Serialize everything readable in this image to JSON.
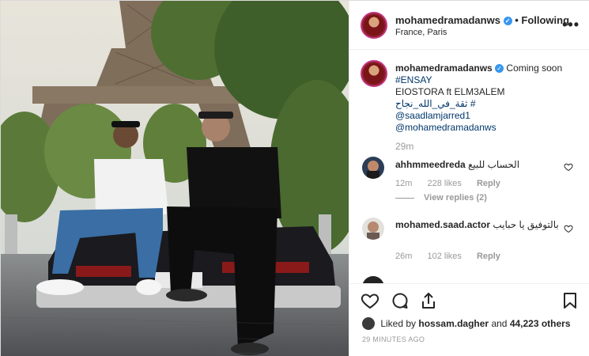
{
  "post": {
    "username": "mohamedramadanws",
    "dot": "•",
    "follow_status": "Following",
    "location": "France, Paris",
    "more_icon": "more-options-icon"
  },
  "caption": {
    "username": "mohamedramadanws",
    "line1": "Coming soon",
    "hashtag": "#ENSAY",
    "line2": "EIOSTORA ft ELM3ALEM",
    "line3": "# ثقة_في_الله_نجاح",
    "mention1": "@saadlamjarred1",
    "mention2": "@mohamedramadanws",
    "time": "29m"
  },
  "comments": [
    {
      "username": "ahhmmeedreda",
      "text": "الحساب للبيع",
      "time": "12m",
      "likes": "228 likes",
      "reply": "Reply",
      "view_replies": "View replies (2)"
    },
    {
      "username": "mohamed.saad.actor",
      "text": "بالتوفيق يا حبايب",
      "time": "26m",
      "likes": "102 likes",
      "reply": "Reply"
    }
  ],
  "actions": {
    "liked_by_prefix": "Liked by",
    "liked_by_user": "hossam.dagher",
    "liked_by_and": "and",
    "liked_by_count": "44,223 others",
    "posted_time": "29 MINUTES AGO"
  },
  "colors": {
    "link": "#00376b",
    "verified": "#3897f0",
    "muted": "#999999"
  }
}
